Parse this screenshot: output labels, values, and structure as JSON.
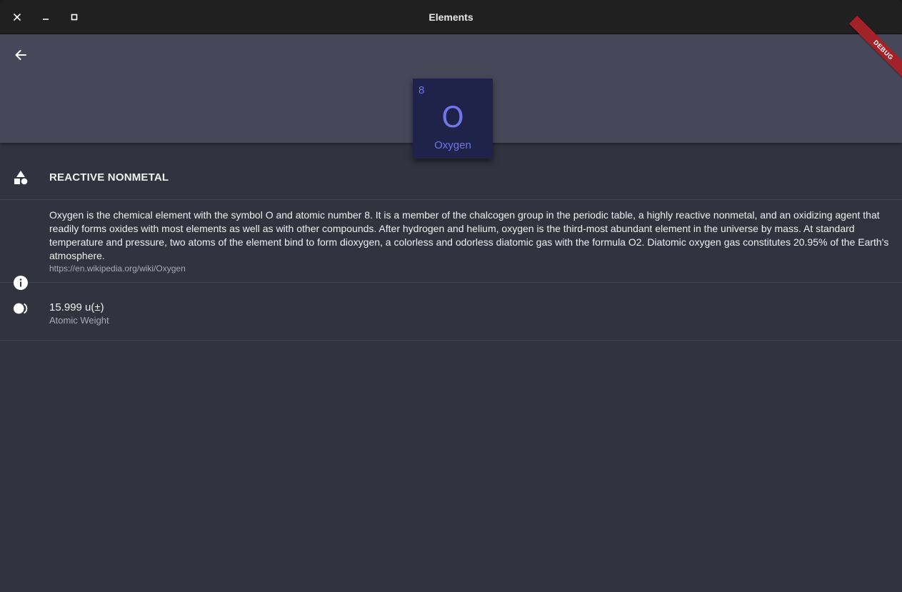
{
  "window": {
    "title": "Elements"
  },
  "appbar": {
    "debug_label": "DEBUG"
  },
  "element": {
    "atomic_number": "8",
    "symbol": "O",
    "name": "Oxygen",
    "tile_color": "#1f2249",
    "accent_color": "#6e78e8"
  },
  "details": {
    "category": "REACTIVE NONMETAL",
    "summary": "Oxygen is the chemical element with the symbol O and atomic number 8. It is a member of the chalcogen group in the periodic table, a highly reactive nonmetal, and an oxidizing agent that readily forms oxides with most elements as well as with other compounds. After hydrogen and helium, oxygen is the third-most abundant element in the universe by mass. At standard temperature and pressure, two atoms of the element bind to form dioxygen, a colorless and odorless diatomic gas with the formula O2. Diatomic oxygen gas constitutes 20.95% of the Earth's atmosphere.",
    "source_url": "https://en.wikipedia.org/wiki/Oxygen",
    "atomic_weight": "15.999 u(±)",
    "atomic_weight_label": "Atomic Weight"
  },
  "icons": {
    "close": "close-icon",
    "minimize": "minimize-icon",
    "maximize": "maximize-icon",
    "back": "arrow-back-icon",
    "category": "category-shapes-icon",
    "info": "info-icon",
    "weight": "weight-icon"
  },
  "colors": {
    "titlebar": "#202020",
    "appbar": "#464859",
    "background": "#31333e",
    "debug_banner": "#a2222a"
  }
}
